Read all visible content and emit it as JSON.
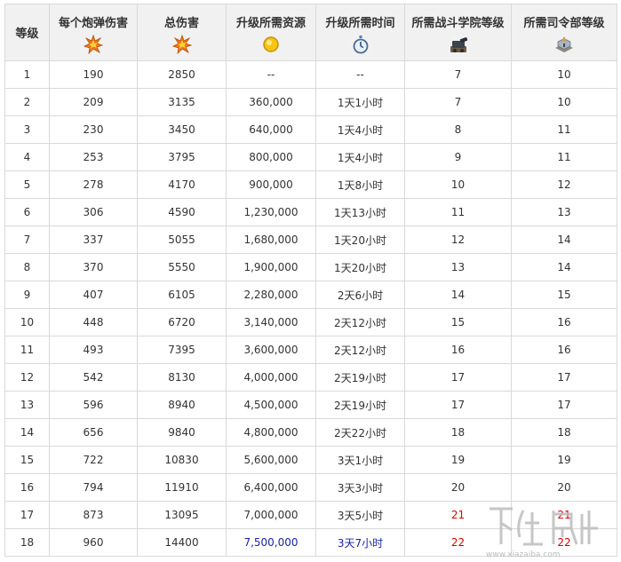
{
  "table": {
    "headers": [
      {
        "label": "等级",
        "icon": ""
      },
      {
        "label": "每个炮弹伤害",
        "icon": "fire-burst-icon"
      },
      {
        "label": "总伤害",
        "icon": "fire-burst-icon"
      },
      {
        "label": "升级所需资源",
        "icon": "gold-coin-icon"
      },
      {
        "label": "升级所需时间",
        "icon": "stopwatch-icon"
      },
      {
        "label": "所需战斗学院等级",
        "icon": "academy-cannon-icon"
      },
      {
        "label": "所需司令部等级",
        "icon": "headquarters-icon"
      }
    ],
    "rows": [
      [
        "1",
        "190",
        "2850",
        "--",
        "--",
        "7",
        "10"
      ],
      [
        "2",
        "209",
        "3135",
        "360,000",
        "1天1小时",
        "7",
        "10"
      ],
      [
        "3",
        "230",
        "3450",
        "640,000",
        "1天4小时",
        "8",
        "11"
      ],
      [
        "4",
        "253",
        "3795",
        "800,000",
        "1天4小时",
        "9",
        "11"
      ],
      [
        "5",
        "278",
        "4170",
        "900,000",
        "1天8小时",
        "10",
        "12"
      ],
      [
        "6",
        "306",
        "4590",
        "1,230,000",
        "1天13小时",
        "11",
        "13"
      ],
      [
        "7",
        "337",
        "5055",
        "1,680,000",
        "1天20小时",
        "12",
        "14"
      ],
      [
        "8",
        "370",
        "5550",
        "1,900,000",
        "1天20小时",
        "13",
        "14"
      ],
      [
        "9",
        "407",
        "6105",
        "2,280,000",
        "2天6小时",
        "14",
        "15"
      ],
      [
        "10",
        "448",
        "6720",
        "3,140,000",
        "2天12小时",
        "15",
        "16"
      ],
      [
        "11",
        "493",
        "7395",
        "3,600,000",
        "2天12小时",
        "16",
        "16"
      ],
      [
        "12",
        "542",
        "8130",
        "4,000,000",
        "2天19小时",
        "17",
        "17"
      ],
      [
        "13",
        "596",
        "8940",
        "4,500,000",
        "2天19小时",
        "17",
        "17"
      ],
      [
        "14",
        "656",
        "9840",
        "4,800,000",
        "2天22小时",
        "18",
        "18"
      ],
      [
        "15",
        "722",
        "10830",
        "5,600,000",
        "3天1小时",
        "19",
        "19"
      ],
      [
        "16",
        "794",
        "11910",
        "6,400,000",
        "3天3小时",
        "20",
        "20"
      ],
      [
        "17",
        "873",
        "13095",
        "7,000,000",
        "3天5小时",
        "21",
        "21"
      ],
      [
        "18",
        "960",
        "14400",
        "7,500,000",
        "3天7小时",
        "22",
        "22"
      ]
    ],
    "highlight_red": "#dd0000",
    "highlight_blue": "#1a23a6"
  },
  "watermark": {
    "text": "下载吧",
    "url": "www.xiazaiba.com",
    "icon": "xiazaiba-logo"
  }
}
